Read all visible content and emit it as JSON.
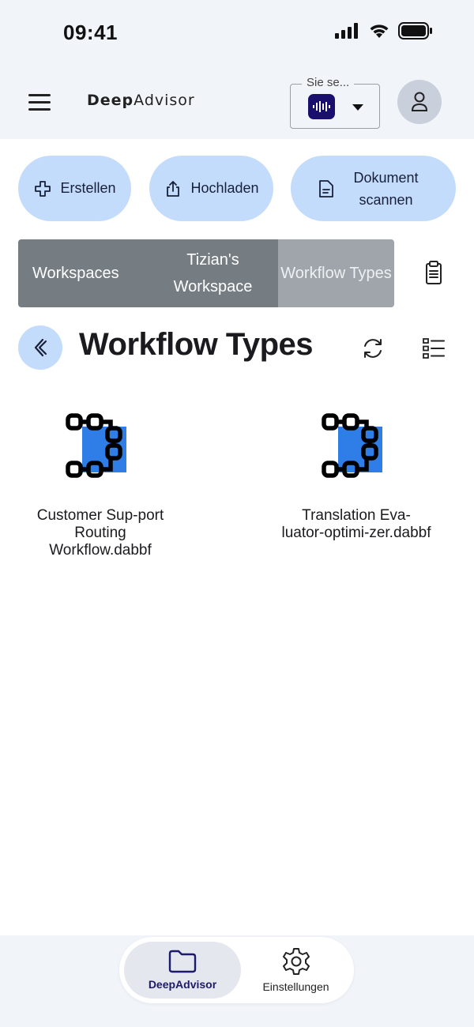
{
  "status": {
    "time": "09:41"
  },
  "app": {
    "brand_part1": "Deep",
    "brand_part2": "Advisor",
    "voice_select_label": "Sie se..."
  },
  "actions": {
    "create": "Erstellen",
    "upload": "Hochladen",
    "scan": "Dokument scannen"
  },
  "breadcrumb": [
    {
      "label": "Workspaces"
    },
    {
      "label": "Tizian's Workspace"
    },
    {
      "label": "Workflow Types"
    }
  ],
  "page": {
    "title": "Workflow Types"
  },
  "files": [
    {
      "name": "Customer Sup-port Routing Workflow.dabbf",
      "icon": "workflow-icon"
    },
    {
      "name": "Translation Eva-luator-optimi-zer.dabbf",
      "icon": "workflow-icon"
    }
  ],
  "bottom_nav": {
    "home": "DeepAdvisor",
    "settings": "Einstellungen"
  },
  "colors": {
    "accent_light": "#c4dcfb",
    "brand_dark": "#1b0f6e",
    "file_blue": "#2f7ee8",
    "breadcrumb_gray": "#757d83"
  }
}
